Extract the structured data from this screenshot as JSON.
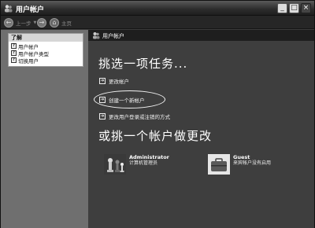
{
  "window": {
    "title": "用户帐户"
  },
  "nav": {
    "back": "上一步",
    "home": "主页"
  },
  "sidebar": {
    "header": "了解",
    "items": [
      {
        "label": "用户帐户",
        "icon": "help-icon"
      },
      {
        "label": "用户帐户类型",
        "icon": "help-icon"
      },
      {
        "label": "切换用户",
        "icon": "help-icon"
      }
    ]
  },
  "content": {
    "header": "用户帐户",
    "task_heading": "挑选一项任务...",
    "tasks": [
      {
        "label": "更改帐户"
      },
      {
        "label": "创建一个新帐户"
      },
      {
        "label": "更改用户登录或注销的方式"
      }
    ],
    "account_heading": "或挑一个帐户做更改",
    "accounts": [
      {
        "name": "Administrator",
        "desc": "计算机管理员",
        "icon": "chess-pieces-picture"
      },
      {
        "name": "Guest",
        "desc": "来宾帐户没有启用",
        "icon": "briefcase-picture"
      }
    ]
  },
  "colors": {
    "title_bar": "#2c2c2c",
    "content_bg": "#3e3e3e",
    "side_panel": "#6f6f6f"
  }
}
